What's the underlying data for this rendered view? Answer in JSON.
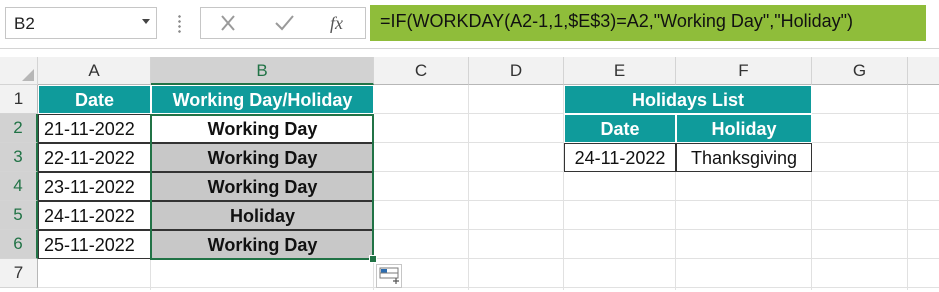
{
  "namebox": {
    "value": "B2"
  },
  "formula": {
    "text": "=IF(WORKDAY(A2-1,1,$E$3)=A2,\"Working Day\",\"Holiday\")"
  },
  "columns": [
    "A",
    "B",
    "C",
    "D",
    "E",
    "F",
    "G"
  ],
  "rows": [
    "1",
    "2",
    "3",
    "4",
    "5",
    "6",
    "7"
  ],
  "icons": {
    "cancel": "close-x-icon",
    "enter": "checkmark-icon",
    "insert_function": "fx-icon",
    "quick_analysis": "quick-analysis-icon"
  },
  "colors": {
    "header_teal": "#0F9B9B",
    "formula_bar_green": "#8FBD3A",
    "selection_green": "#217346",
    "cell_gray": "#C8C8C8"
  },
  "main_table": {
    "headers": [
      "Date",
      "Working Day/Holiday"
    ],
    "rows": [
      {
        "date": "21-11-2022",
        "status": "Working Day"
      },
      {
        "date": "22-11-2022",
        "status": "Working Day"
      },
      {
        "date": "23-11-2022",
        "status": "Working Day"
      },
      {
        "date": "24-11-2022",
        "status": "Holiday"
      },
      {
        "date": "25-11-2022",
        "status": "Working Day"
      }
    ]
  },
  "holidays_table": {
    "title": "Holidays List",
    "headers": [
      "Date",
      "Holiday"
    ],
    "rows": [
      {
        "date": "24-11-2022",
        "holiday": "Thanksgiving"
      }
    ]
  }
}
